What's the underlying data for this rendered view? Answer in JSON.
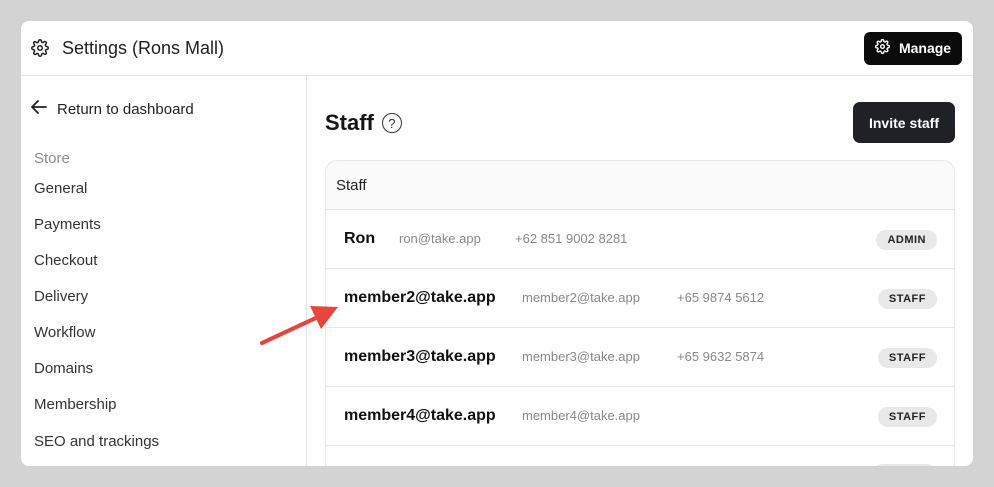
{
  "header": {
    "title": "Settings (Rons Mall)",
    "manage_label": "Manage",
    "icon": "gear-icon"
  },
  "sidebar": {
    "back_label": "Return to dashboard",
    "section_label": "Store",
    "items": [
      {
        "label": "General"
      },
      {
        "label": "Payments"
      },
      {
        "label": "Checkout"
      },
      {
        "label": "Delivery"
      },
      {
        "label": "Workflow"
      },
      {
        "label": "Domains"
      },
      {
        "label": "Membership"
      },
      {
        "label": "SEO and trackings"
      }
    ]
  },
  "main": {
    "title": "Staff",
    "help_glyph": "?",
    "invite_label": "Invite staff",
    "table_header": "Staff",
    "rows": [
      {
        "name": "Ron",
        "email": "ron@take.app",
        "phone": "+62 851 9002 8281",
        "role": "ADMIN"
      },
      {
        "name": "member2@take.app",
        "email": "member2@take.app",
        "phone": "+65 9874 5612",
        "role": "STAFF"
      },
      {
        "name": "member3@take.app",
        "email": "member3@take.app",
        "phone": "+65 9632 5874",
        "role": "STAFF"
      },
      {
        "name": "member4@take.app",
        "email": "member4@take.app",
        "phone": "",
        "role": "STAFF"
      }
    ]
  },
  "colors": {
    "accent_dark": "#0b0b0b",
    "invite_button": "#1e2227",
    "annotation_arrow": "#e8453c"
  }
}
